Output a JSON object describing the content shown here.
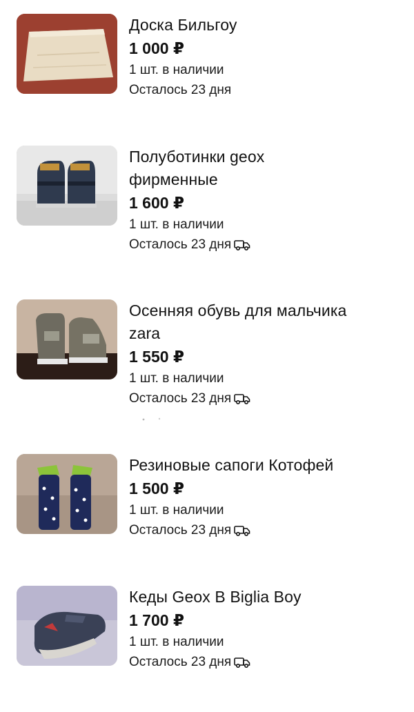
{
  "items": [
    {
      "title": "Доска Бильгоу",
      "price": "1 000 ₽",
      "stock": "1 шт. в наличии",
      "remaining": "Осталось 23 дня",
      "delivery": false
    },
    {
      "title": "Полуботинки geox фирменные",
      "price": "1 600 ₽",
      "stock": "1 шт. в наличии",
      "remaining": "Осталось 23 дня",
      "delivery": true
    },
    {
      "title": "Осенняя обувь для мальчика zara",
      "price": "1 550 ₽",
      "stock": "1 шт. в наличии",
      "remaining": "Осталось 23 дня",
      "delivery": true
    },
    {
      "title": "Резиновые сапоги Котофей",
      "price": "1 500 ₽",
      "stock": "1 шт. в наличии",
      "remaining": "Осталось 23 дня",
      "delivery": true
    },
    {
      "title": "Кеды Geox B Biglia Boy",
      "price": "1 700 ₽",
      "stock": "1 шт. в наличии",
      "remaining": "Осталось 23 дня",
      "delivery": true
    }
  ],
  "icons": {
    "delivery": "truck-icon"
  }
}
